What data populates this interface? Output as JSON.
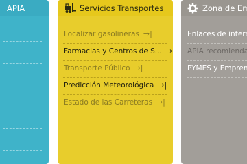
{
  "panels": {
    "left": {
      "title": "APIA",
      "color": "#3fb3c9"
    },
    "middle": {
      "title": "Servicios Transportes",
      "icon": "forklift-icon",
      "color": "#e8cd2c",
      "items": [
        {
          "label": "Localizar gasolineras",
          "arrow": "→|"
        },
        {
          "label": "Farmacias y Centros de S...",
          "arrow": "→|"
        },
        {
          "label": "Transporte Público",
          "arrow": "→|"
        },
        {
          "label": "Predicción Meteorológica",
          "arrow": "→|"
        },
        {
          "label": "Estado de las Carreteras",
          "arrow": "→|"
        }
      ]
    },
    "right": {
      "title": "Zona de Empr",
      "icon": "gear-icon",
      "color": "#a29e99",
      "items": [
        {
          "label": "Enlaces de interés"
        },
        {
          "label": "APIA recomienda"
        },
        {
          "label": "PYMES y Emprende"
        }
      ]
    }
  }
}
